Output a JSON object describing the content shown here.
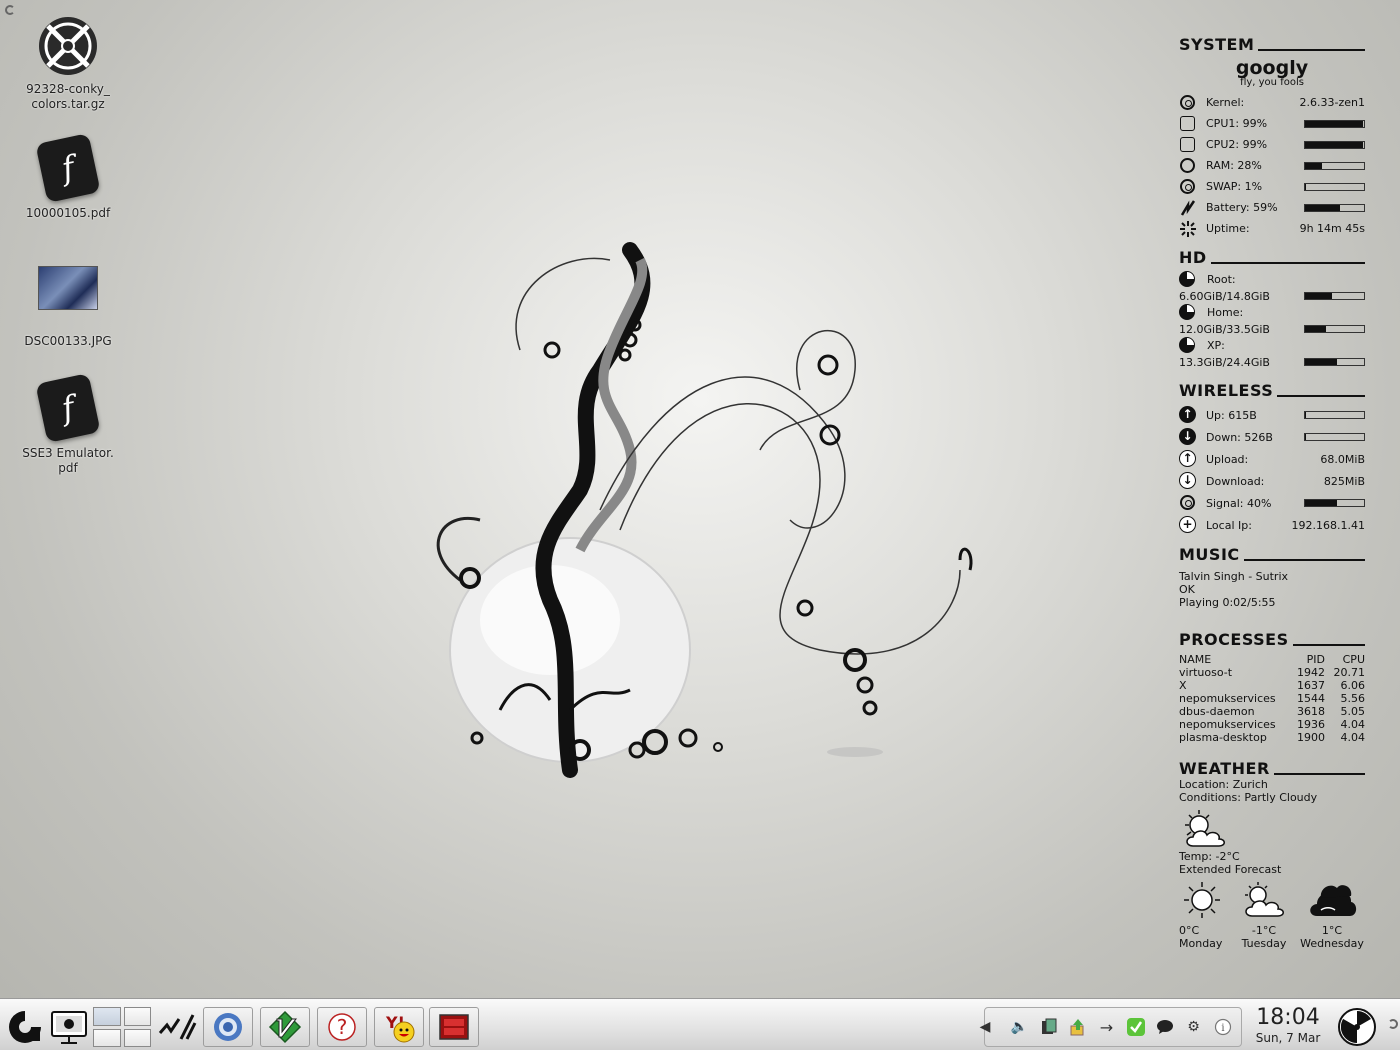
{
  "desktop_icons": [
    {
      "name": "92328-conky_ colors.tar.gz",
      "line1": "92328-conky_",
      "line2": "colors.tar.gz",
      "kind": "archive-icon"
    },
    {
      "name": "10000105.pdf",
      "line1": "10000105.pdf",
      "line2": "",
      "kind": "pdf-icon"
    },
    {
      "name": "DSC00133.JPG",
      "line1": "DSC00133.JPG",
      "line2": "",
      "kind": "image-icon"
    },
    {
      "name": "SSE3 Emulator. pdf",
      "line1": "SSE3 Emulator.",
      "line2": "pdf",
      "kind": "pdf-icon"
    }
  ],
  "conky": {
    "system": {
      "title": "SYSTEM",
      "hostname": "googly",
      "tagline": "fly, you fools",
      "rows": [
        {
          "label": "Kernel:",
          "value": "2.6.33-zen1",
          "icon": "kernel-icon"
        },
        {
          "label": "CPU1: 99%",
          "bar": 0.99,
          "icon": "cpu-icon"
        },
        {
          "label": "CPU2: 99%",
          "bar": 0.99,
          "icon": "cpu-icon"
        },
        {
          "label": "RAM: 28%",
          "bar": 0.28,
          "icon": "ram-icon"
        },
        {
          "label": "SWAP: 1%",
          "bar": 0.01,
          "icon": "swap-icon"
        },
        {
          "label": "Battery: 59%",
          "bar": 0.59,
          "icon": "battery-icon"
        },
        {
          "label": "Uptime:",
          "value": "9h 14m 45s",
          "icon": "uptime-icon"
        }
      ]
    },
    "hd": {
      "title": "HD",
      "rows": [
        {
          "label": "Root:",
          "usage": "6.60GiB/14.8GiB",
          "bar": 0.45
        },
        {
          "label": "Home:",
          "usage": "12.0GiB/33.5GiB",
          "bar": 0.36
        },
        {
          "label": "XP:",
          "usage": "13.3GiB/24.4GiB",
          "bar": 0.55
        }
      ]
    },
    "wireless": {
      "title": "WIRELESS",
      "rows": [
        {
          "label": "Up: 615B",
          "bar": 0.02,
          "icon": "upload-speed-icon"
        },
        {
          "label": "Down: 526B",
          "bar": 0.02,
          "icon": "download-speed-icon"
        },
        {
          "label": "Upload:",
          "value": "68.0MiB",
          "icon": "upload-total-icon"
        },
        {
          "label": "Download:",
          "value": "825MiB",
          "icon": "download-total-icon"
        },
        {
          "label": "Signal: 40%",
          "bar": 0.55,
          "icon": "signal-icon"
        },
        {
          "label": "Local Ip:",
          "value": "192.168.1.41",
          "icon": "local-ip-icon"
        }
      ]
    },
    "music": {
      "title": "MUSIC",
      "track": "Talvin Singh - Sutrix",
      "album": "OK",
      "status": "Playing 0:02/5:55"
    },
    "processes": {
      "title": "PROCESSES",
      "headers": {
        "name": "NAME",
        "pid": "PID",
        "cpu": "CPU"
      },
      "rows": [
        {
          "name": "virtuoso-t",
          "pid": "1942",
          "cpu": "20.71"
        },
        {
          "name": "X",
          "pid": "1637",
          "cpu": "6.06"
        },
        {
          "name": "nepomukservices",
          "pid": "1544",
          "cpu": "5.56"
        },
        {
          "name": "dbus-daemon",
          "pid": "3618",
          "cpu": "5.05"
        },
        {
          "name": "nepomukservices",
          "pid": "1936",
          "cpu": "4.04"
        },
        {
          "name": "plasma-desktop",
          "pid": "1900",
          "cpu": "4.04"
        }
      ]
    },
    "weather": {
      "title": "WEATHER",
      "location": "Location: Zurich",
      "conditions": "Conditions: Partly Cloudy",
      "temp": "Temp: -2°C",
      "extended_label": "Extended Forecast",
      "forecast": [
        {
          "temp": "0°C",
          "day": "Monday",
          "icon": "sunny-icon"
        },
        {
          "temp": "-1°C",
          "day": "Tuesday",
          "icon": "partly-cloudy-icon"
        },
        {
          "temp": "1°C",
          "day": "Wednesday",
          "icon": "cloudy-icon"
        }
      ]
    }
  },
  "taskbar": {
    "launchers": [
      "kde-menu-icon",
      "desktop-icon",
      "activity-icon"
    ],
    "tasks": [
      "chromium-task",
      "vim-task",
      "help-task",
      "yahoo-messenger-task",
      "terminal-task"
    ],
    "tray_icons": [
      "volume-icon",
      "klipper-icon",
      "update-icon",
      "usb-icon",
      "check-icon",
      "chat-icon",
      "network-icon",
      "info-icon"
    ],
    "clock_time": "18:04",
    "clock_date": "Sun, 7 Mar"
  }
}
